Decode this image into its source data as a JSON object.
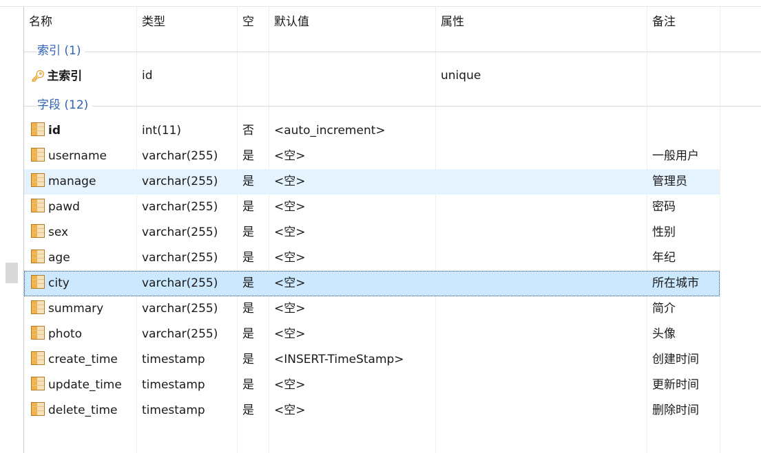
{
  "columns": [
    "名称",
    "类型",
    "空",
    "默认值",
    "属性",
    "备注"
  ],
  "index_group": {
    "label": "索引 (1)"
  },
  "index_row": {
    "name": "主索引",
    "type": "id",
    "attr": "unique",
    "icon": "key-icon"
  },
  "fields_group": {
    "label": "字段 (12)"
  },
  "fields": [
    {
      "name": "id",
      "type": "int(11)",
      "null": "否",
      "default": "<auto_increment>",
      "note": ""
    },
    {
      "name": "username",
      "type": "varchar(255)",
      "null": "是",
      "default": "<空>",
      "note": "一般用户"
    },
    {
      "name": "manage",
      "type": "varchar(255)",
      "null": "是",
      "default": "<空>",
      "note": "管理员"
    },
    {
      "name": "pawd",
      "type": "varchar(255)",
      "null": "是",
      "default": "<空>",
      "note": "密码"
    },
    {
      "name": "sex",
      "type": "varchar(255)",
      "null": "是",
      "default": "<空>",
      "note": "性别"
    },
    {
      "name": "age",
      "type": "varchar(255)",
      "null": "是",
      "default": "<空>",
      "note": "年纪"
    },
    {
      "name": "city",
      "type": "varchar(255)",
      "null": "是",
      "default": "<空>",
      "note": "所在城市"
    },
    {
      "name": "summary",
      "type": "varchar(255)",
      "null": "是",
      "default": "<空>",
      "note": "简介"
    },
    {
      "name": "photo",
      "type": "varchar(255)",
      "null": "是",
      "default": "<空>",
      "note": "头像"
    },
    {
      "name": "create_time",
      "type": "timestamp",
      "null": "是",
      "default": "<INSERT-TimeStamp>",
      "note": "创建时间"
    },
    {
      "name": "update_time",
      "type": "timestamp",
      "null": "是",
      "default": "<空>",
      "note": "更新时间"
    },
    {
      "name": "delete_time",
      "type": "timestamp",
      "null": "是",
      "default": "<空>",
      "note": "删除时间"
    }
  ],
  "hover_row": "manage",
  "selected_row": "city",
  "colors": {
    "group_label": "#2f63b8",
    "hover": "#e5f3ff",
    "selected": "#cce8ff",
    "field_icon": "#f2b24a"
  }
}
